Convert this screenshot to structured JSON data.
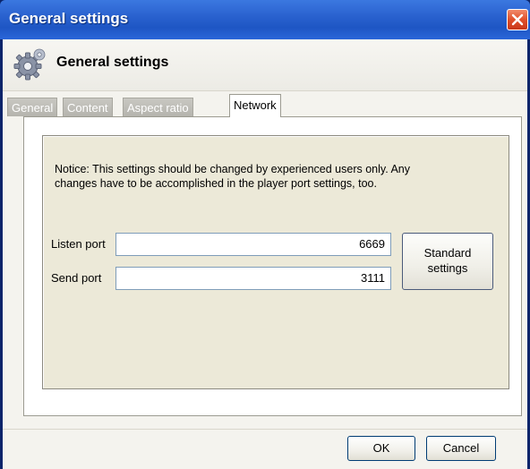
{
  "window": {
    "title": "General settings"
  },
  "header": {
    "title": "General settings",
    "icon": "gear-icon"
  },
  "tabs": [
    {
      "label": "General",
      "active": false
    },
    {
      "label": "Content",
      "active": false
    },
    {
      "label": "Aspect ratio",
      "active": false
    },
    {
      "label": "Network",
      "active": true
    }
  ],
  "network": {
    "notice_line1": "Notice: This settings should be changed by experienced users only. Any",
    "notice_line2": "changes have to be accomplished in the player port settings, too.",
    "listen_port_label": "Listen port",
    "listen_port_value": "6669",
    "send_port_label": "Send port",
    "send_port_value": "3111",
    "standard_line1": "Standard",
    "standard_line2": "settings"
  },
  "footer": {
    "ok_label": "OK",
    "cancel_label": "Cancel"
  },
  "colors": {
    "titlebar": "#2a62cf",
    "close": "#e0502a",
    "panel": "#ece9d8"
  }
}
